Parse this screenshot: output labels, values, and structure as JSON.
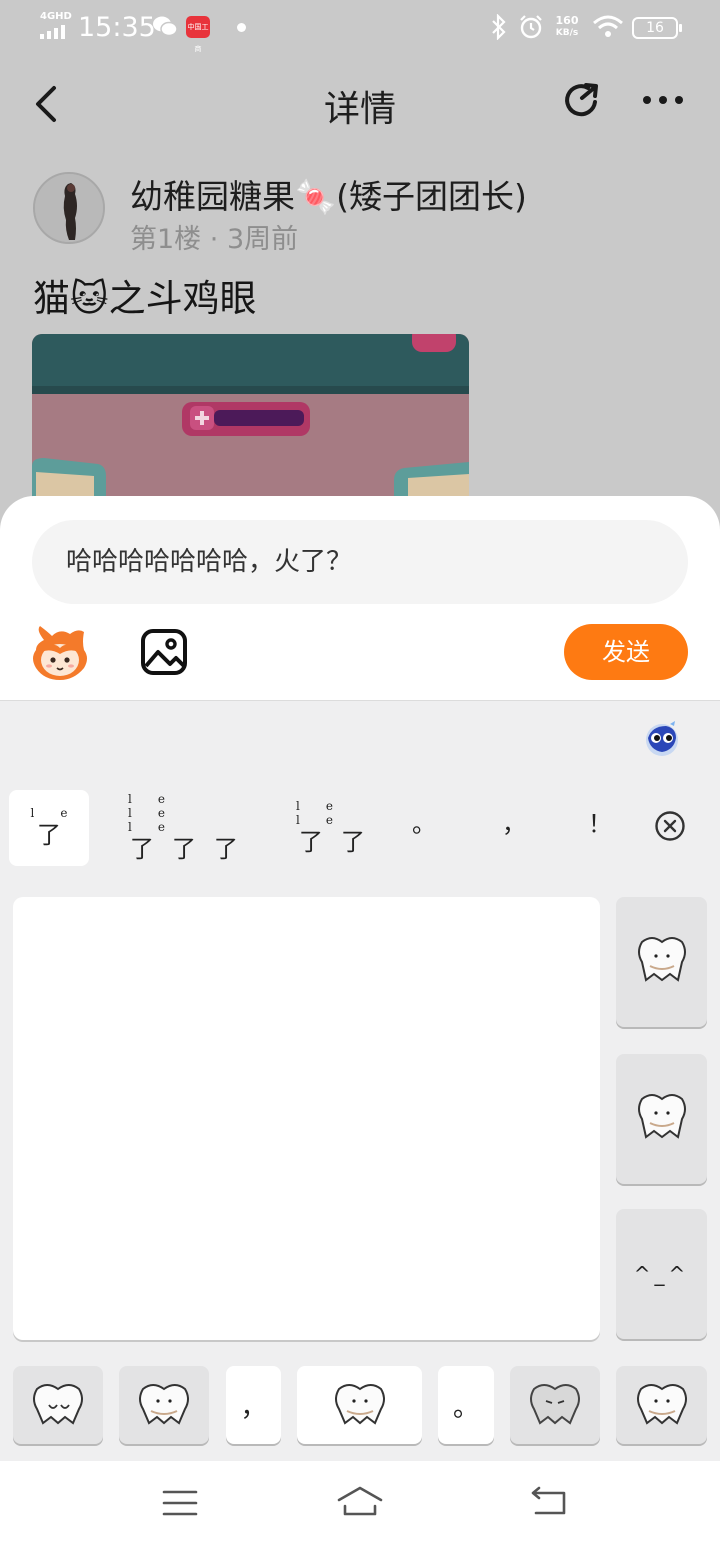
{
  "status_bar": {
    "network": "4GHD",
    "time": "15:35",
    "app_icon_text": "中国工商",
    "net_speed_value": "160",
    "net_speed_unit": "KB/s",
    "battery": "16",
    "icons": [
      "signal-icon",
      "wechat-icon",
      "app-notification-icon",
      "bluetooth-icon",
      "alarm-icon",
      "wifi-icon",
      "battery-icon"
    ]
  },
  "header": {
    "title": "详情",
    "icons": [
      "back-arrow-icon",
      "share-icon",
      "more-icon"
    ]
  },
  "post": {
    "username": "幼稚园糖果🍬(矮子团团长)",
    "floor": "第1楼",
    "separator": "·",
    "time_ago": "3周前",
    "title": "猫🐱之斗鸡眼"
  },
  "reply": {
    "input_value": "哈哈哈哈哈哈哈，火了？",
    "send_label": "发送",
    "icons": [
      "emoji-mascot-icon",
      "image-icon"
    ]
  },
  "keyboard": {
    "candidates": [
      {
        "pinyin": "le",
        "hanzi": "了"
      },
      {
        "pinyin": "le le le",
        "hanzi": "了了了"
      },
      {
        "pinyin": "le le",
        "hanzi": "了了"
      }
    ],
    "candidate_punct": [
      "。",
      "，",
      "！"
    ],
    "side_key_text": "^_^",
    "bottom_comma": "，",
    "bottom_period": "。"
  },
  "colors": {
    "accent": "#fe7a12",
    "dim_overlay": "#c9c9c9",
    "keyboard_bg": "#efeff0"
  }
}
